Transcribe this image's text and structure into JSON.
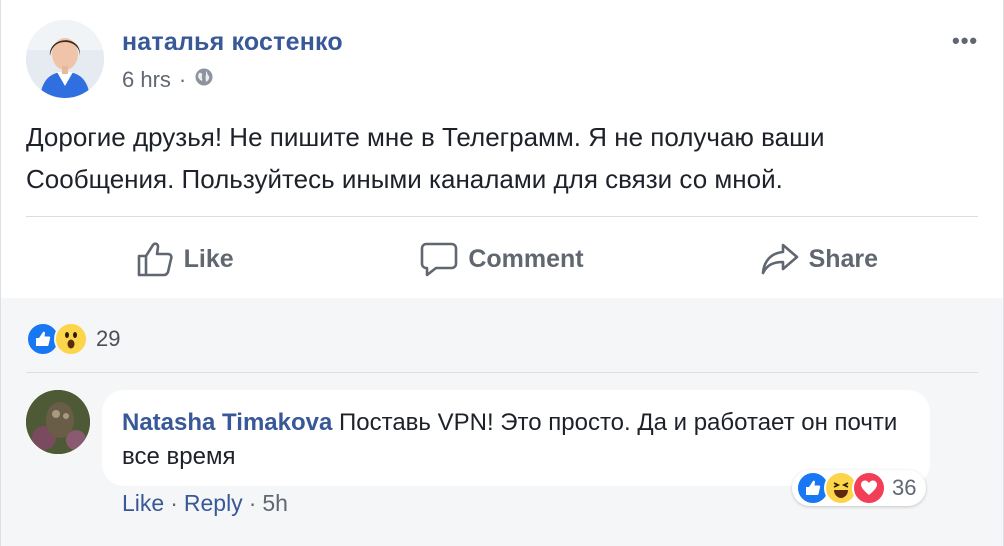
{
  "post": {
    "author": "наталья костенко",
    "time": "6 hrs",
    "separator": "·",
    "privacy_icon": "globe-icon",
    "more_label": "•••",
    "text": "Дорогие друзья! Не пишите мне в Телеграмм. Я не получаю ваши Сообщения. Пользуйтесь иными каналами для связи со мной.",
    "actions": {
      "like": "Like",
      "comment": "Comment",
      "share": "Share"
    },
    "reactions": {
      "icons": [
        "like-reaction-icon",
        "wow-reaction-icon"
      ],
      "count": "29"
    }
  },
  "comment": {
    "author": "Natasha Timakova",
    "text": "Поставь VPN! Это просто. Да и работает он почти все время",
    "reactions": {
      "icons": [
        "like-reaction-icon",
        "haha-reaction-icon",
        "love-reaction-icon"
      ],
      "count": "36"
    },
    "actions": {
      "like": "Like",
      "reply": "Reply",
      "time": "5h",
      "separator": "·"
    }
  },
  "colors": {
    "link_blue": "#385898",
    "like_blue": "#1877f2",
    "love_red": "#f33e58",
    "emoji_yellow": "#fcd54b",
    "secondary_text": "#606770"
  }
}
